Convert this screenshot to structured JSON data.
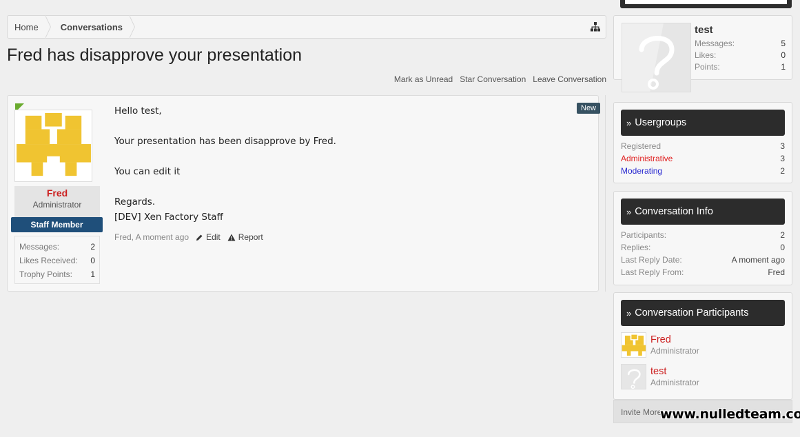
{
  "breadcrumb": {
    "home": "Home",
    "current": "Conversations"
  },
  "page_title": "Fred has disapprove your presentation",
  "actions": {
    "mark_unread": "Mark as Unread",
    "star": "Star Conversation",
    "leave": "Leave Conversation"
  },
  "message": {
    "author": "Fred",
    "author_title": "Administrator",
    "staff_banner": "Staff Member",
    "stats": [
      {
        "label": "Messages:",
        "value": "2"
      },
      {
        "label": "Likes Received:",
        "value": "0"
      },
      {
        "label": "Trophy Points:",
        "value": "1"
      }
    ],
    "new_badge": "New",
    "body": {
      "line1": "Hello test,",
      "line2": "Your presentation has been disapprove by Fred.",
      "line3": "You can edit it",
      "line4": "Regards.",
      "line5": "[DEV] Xen Factory Staff"
    },
    "meta": {
      "byline": "Fred, A moment ago",
      "edit": "Edit",
      "report": "Report"
    }
  },
  "visitor": {
    "name": "test",
    "stats": [
      {
        "label": "Messages:",
        "value": "5"
      },
      {
        "label": "Likes:",
        "value": "0"
      },
      {
        "label": "Points:",
        "value": "1"
      }
    ]
  },
  "usergroups": {
    "title": "Usergroups",
    "rows": [
      {
        "label": "Registered",
        "value": "3",
        "color": "#888888"
      },
      {
        "label": "Administrative",
        "value": "3",
        "color": "#e02020"
      },
      {
        "label": "Moderating",
        "value": "2",
        "color": "#2a2ad0"
      }
    ]
  },
  "conv_info": {
    "title": "Conversation Info",
    "rows": [
      {
        "label": "Participants:",
        "value": "2"
      },
      {
        "label": "Replies:",
        "value": "0"
      },
      {
        "label": "Last Reply Date:",
        "value": "A moment ago"
      },
      {
        "label": "Last Reply From:",
        "value": "Fred"
      }
    ]
  },
  "participants": {
    "title": "Conversation Participants",
    "list": [
      {
        "name": "Fred",
        "title": "Administrator"
      },
      {
        "name": "test",
        "title": "Administrator"
      }
    ]
  },
  "invite": "Invite More",
  "watermark": "www.nulledteam.com"
}
